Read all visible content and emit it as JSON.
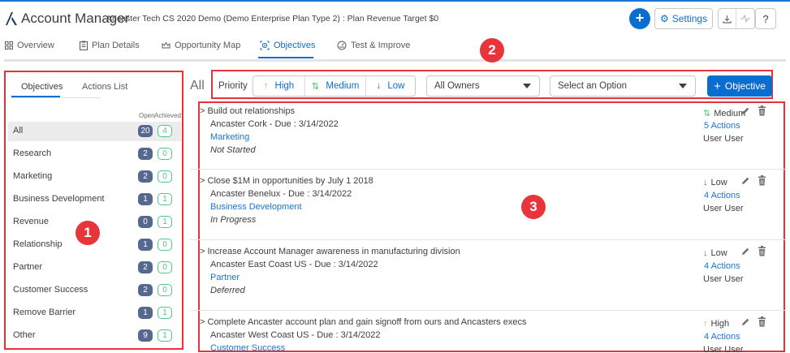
{
  "header": {
    "app_title": "Account Manager",
    "subtitle": "Ancaster Tech CS 2020 Demo (Demo Enterprise Plan Type 2) : Plan Revenue Target $0",
    "add_label": "+",
    "settings_label": "Settings",
    "help_label": "?"
  },
  "tabs": [
    {
      "label": "Overview",
      "icon": "grid-icon"
    },
    {
      "label": "Plan Details",
      "icon": "clipboard-icon"
    },
    {
      "label": "Opportunity Map",
      "icon": "crown-icon"
    },
    {
      "label": "Objectives",
      "icon": "target-icon",
      "active": true
    },
    {
      "label": "Test & Improve",
      "icon": "gauge-icon"
    }
  ],
  "left_panel": {
    "tabs": [
      "Objectives",
      "Actions List"
    ],
    "open_header": "Open",
    "achieved_header": "Achieved",
    "categories": [
      {
        "label": "All",
        "open": "20",
        "achieved": "4",
        "selected": true
      },
      {
        "label": "Research",
        "open": "2",
        "achieved": "0"
      },
      {
        "label": "Marketing",
        "open": "2",
        "achieved": "0"
      },
      {
        "label": "Business Development",
        "open": "1",
        "achieved": "1"
      },
      {
        "label": "Revenue",
        "open": "0",
        "achieved": "1"
      },
      {
        "label": "Relationship",
        "open": "1",
        "achieved": "0"
      },
      {
        "label": "Partner",
        "open": "2",
        "achieved": "0"
      },
      {
        "label": "Customer Success",
        "open": "2",
        "achieved": "0"
      },
      {
        "label": "Remove Barrier",
        "open": "1",
        "achieved": "1"
      },
      {
        "label": "Other",
        "open": "9",
        "achieved": "1"
      }
    ]
  },
  "filter": {
    "all_label": "All",
    "priority_label": "Priority",
    "high": "High",
    "medium": "Medium",
    "low": "Low",
    "owner_select": "All Owners",
    "option_select": "Select an Option",
    "add_objective": "Objective"
  },
  "objectives": [
    {
      "title": "Build out relationships",
      "subtitle": "Ancaster Cork  - Due : 3/14/2022",
      "category": "Marketing",
      "status": "Not Started",
      "priority": "Medium",
      "priority_level": "medium",
      "actions": "5 Actions",
      "owner": "User User"
    },
    {
      "title": "Close $1M in opportunities by July 1 2018",
      "subtitle": "Ancaster Benelux  - Due : 3/14/2022",
      "category": "Business Development",
      "status": "In Progress",
      "priority": "Low",
      "priority_level": "low",
      "actions": "4 Actions",
      "owner": "User User"
    },
    {
      "title": "Increase Account Manager awareness in manufacturing division",
      "subtitle": "Ancaster East Coast US  - Due : 3/14/2022",
      "category": "Partner",
      "status": "Deferred",
      "priority": "Low",
      "priority_level": "low",
      "actions": "4 Actions",
      "owner": "User User"
    },
    {
      "title": "Complete Ancaster account plan and gain signoff from ours and Ancasters execs",
      "subtitle": "Ancaster West Coast US  - Due : 3/14/2022",
      "category": "Customer Success",
      "status": "",
      "priority": "High",
      "priority_level": "high",
      "actions": "4 Actions",
      "owner": "User User"
    }
  ],
  "annotations": [
    "1",
    "2",
    "3"
  ],
  "colors": {
    "accent": "#0a6ed1",
    "annotation": "#e6323a",
    "achieved": "#4bca81",
    "open_pill": "#54698d",
    "high": "#ff9a3c"
  }
}
